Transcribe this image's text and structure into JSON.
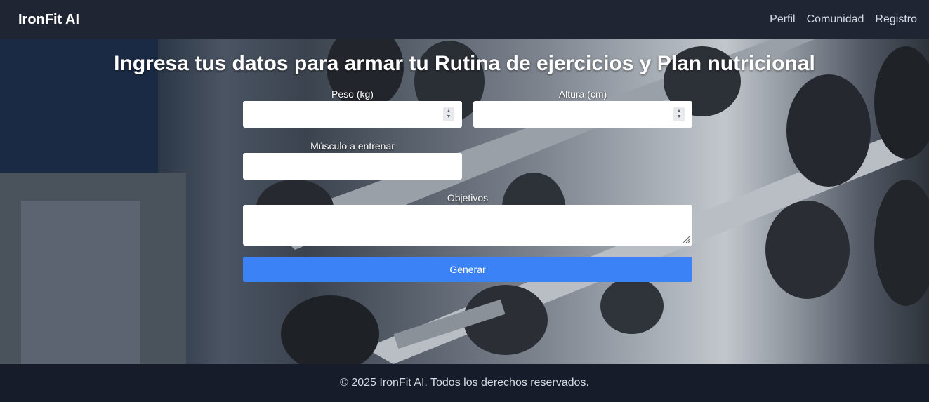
{
  "navbar": {
    "brand": "IronFit AI",
    "links": [
      {
        "label": "Perfil"
      },
      {
        "label": "Comunidad"
      },
      {
        "label": "Registro"
      }
    ]
  },
  "hero": {
    "title": "Ingresa tus datos para armar tu Rutina de ejercicios y Plan nutricional"
  },
  "form": {
    "peso": {
      "label": "Peso (kg)",
      "value": ""
    },
    "altura": {
      "label": "Altura (cm)",
      "value": ""
    },
    "musculo": {
      "label": "Músculo a entrenar",
      "value": ""
    },
    "objetivos": {
      "label": "Objetivos",
      "value": ""
    },
    "submit_label": "Generar"
  },
  "footer": {
    "text": "© 2025 IronFit AI. Todos los derechos reservados."
  },
  "colors": {
    "navbar_bg": "#1f2532",
    "footer_bg": "#171c2a",
    "button_bg": "#3b82f6"
  }
}
